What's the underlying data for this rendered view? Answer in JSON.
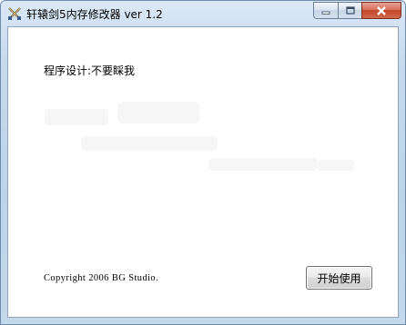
{
  "window": {
    "title": "轩辕剑5内存修改器 ver 1.2",
    "app_icon": "crossed-swords-icon",
    "caption_buttons": {
      "minimize": "minimize-icon",
      "maximize": "maximize-icon",
      "close": "close-icon"
    }
  },
  "content": {
    "author_text": "程序设计:不要睬我",
    "copyright_text": "Copyright 2006 BG Studio.",
    "start_button_label": "开始使用"
  },
  "colors": {
    "titlebar": "#c4d8ec",
    "close_button": "#c4452d",
    "client_background": "#ffffff"
  }
}
